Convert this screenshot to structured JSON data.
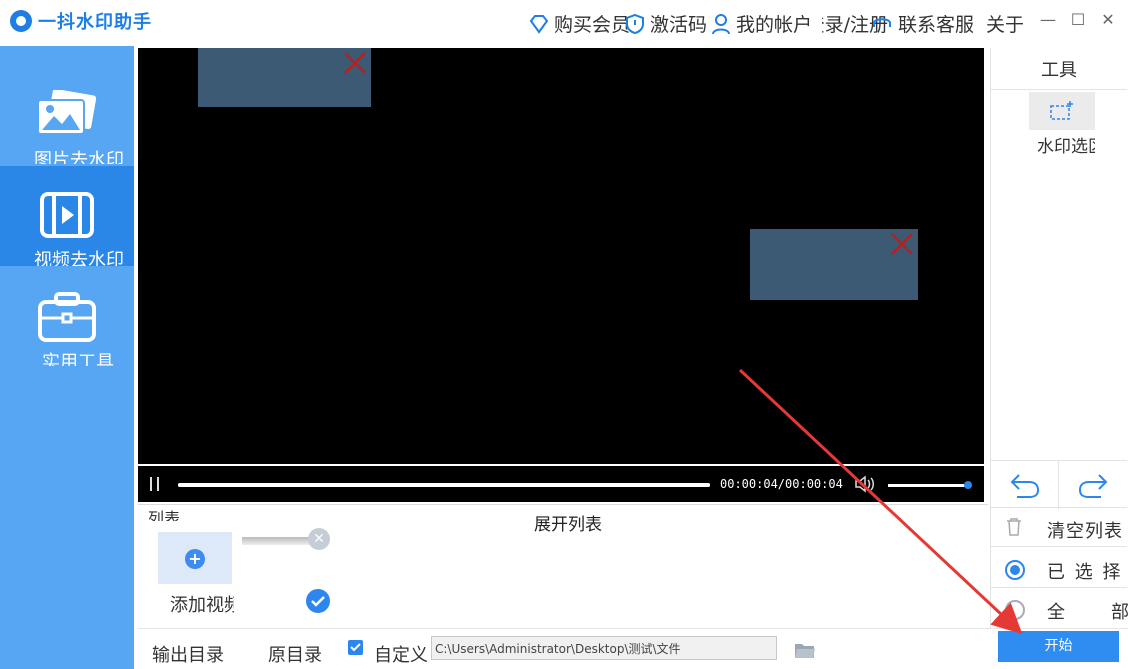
{
  "app": {
    "name": "一抖水印助手"
  },
  "topnav": {
    "buy_vip": "购买会员",
    "activate": "激活码",
    "my_account": "我的帐户",
    "login_register": "登录/注册",
    "contact": "联系客服",
    "about": "关于"
  },
  "window": {
    "minimize": "—",
    "maximize": "☐",
    "close": "✕"
  },
  "sidebar": {
    "items": [
      {
        "label": "图片去水印",
        "icon": "image-icon"
      },
      {
        "label": "视频去水印",
        "icon": "film-icon",
        "active": true
      },
      {
        "label": "实用工具",
        "icon": "toolbox-icon"
      }
    ]
  },
  "player": {
    "timecode": "00:00:04/00:00:04",
    "progress": 1.0,
    "volume": 0.95
  },
  "list": {
    "label": "列表",
    "expand": "展开列表",
    "add_video": "添加视频"
  },
  "tools": {
    "header": "工具",
    "watermark_select": "水印选区",
    "clear_list": "清空列表",
    "selected": "已 选 择",
    "all": "全　部"
  },
  "output": {
    "label": "输出目录",
    "original_dir": "原目录",
    "custom": "自定义",
    "path": "C:\\Users\\Administrator\\Desktop\\测试\\文件",
    "start": "开始"
  },
  "colors": {
    "sidebar": "#56a6f3",
    "sidebar_active": "#2a87e8",
    "accent": "#2f8cf0",
    "arrow": "#e53935"
  }
}
